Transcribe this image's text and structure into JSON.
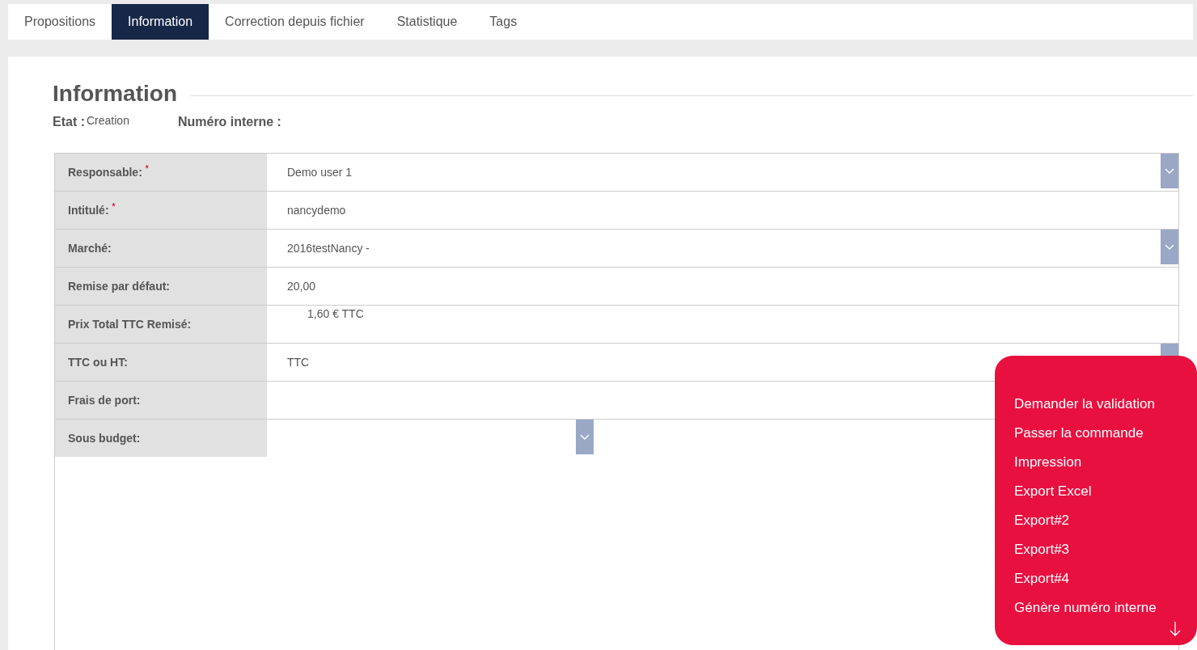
{
  "tabs": [
    {
      "label": "Propositions",
      "selected": false
    },
    {
      "label": "Information",
      "selected": true
    },
    {
      "label": "Correction depuis fichier",
      "selected": false
    },
    {
      "label": "Statistique",
      "selected": false
    },
    {
      "label": "Tags",
      "selected": false
    }
  ],
  "section_title": "Information",
  "status": {
    "etat_label": "Etat :",
    "etat_value": "Creation",
    "numero_label": "Numéro interne :"
  },
  "fields": [
    {
      "label": "Responsable:",
      "required_mark": "*",
      "kind": "select",
      "value": "Demo user 1"
    },
    {
      "label": "Intitulé:",
      "required_mark": "*",
      "kind": "text",
      "value": "nancydemo"
    },
    {
      "label": "Marché:",
      "kind": "select",
      "value": "2016testNancy -"
    },
    {
      "label": "Remise par défaut:",
      "kind": "text",
      "value": "20,00"
    },
    {
      "label": "Prix Total TTC Remisé:",
      "kind": "readonly",
      "value": "1,60 € TTC"
    },
    {
      "label": "TTC ou HT:",
      "kind": "select",
      "value": "TTC"
    },
    {
      "label": "Frais de port:",
      "kind": "text"
    },
    {
      "label": "Sous budget:",
      "kind": "short_select"
    }
  ],
  "action_menu": {
    "items": [
      "Demander la validation",
      "Passer la commande",
      "Impression",
      "Export Excel",
      "Export#2",
      "Export#3",
      "Export#4",
      "Génère numéro interne"
    ]
  }
}
